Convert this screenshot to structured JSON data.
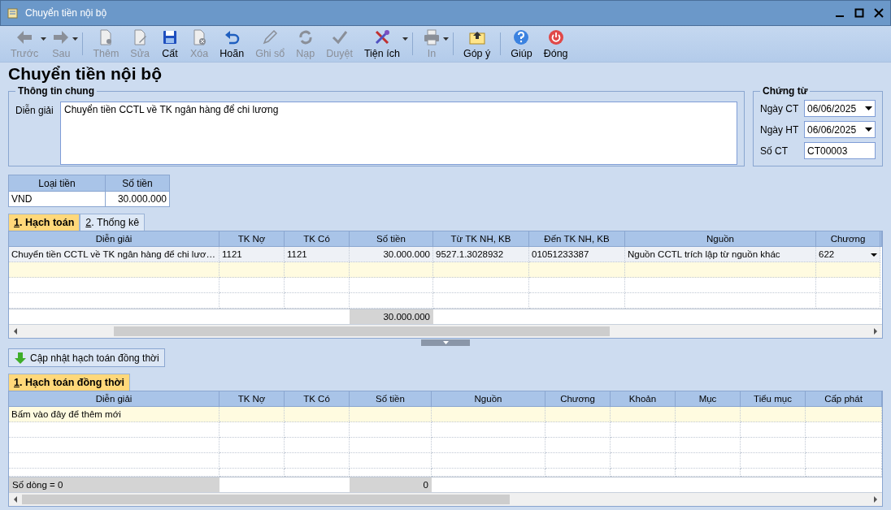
{
  "window": {
    "title": "Chuyển tiền nội bộ"
  },
  "toolbar": [
    [
      {
        "label": "Trước",
        "disabled": true,
        "dropdown": true
      },
      {
        "label": "Sau",
        "disabled": true,
        "dropdown": true
      }
    ],
    [
      {
        "label": "Thêm",
        "disabled": true,
        "dropdown": false
      },
      {
        "label": "Sửa",
        "disabled": true,
        "dropdown": false
      },
      {
        "label": "Cất",
        "disabled": false,
        "dropdown": false
      },
      {
        "label": "Xóa",
        "disabled": true,
        "dropdown": false
      },
      {
        "label": "Hoãn",
        "disabled": false,
        "dropdown": false
      },
      {
        "label": "Ghi sổ",
        "disabled": true,
        "dropdown": false
      },
      {
        "label": "Nạp",
        "disabled": true,
        "dropdown": false
      },
      {
        "label": "Duyệt",
        "disabled": true,
        "dropdown": false
      },
      {
        "label": "Tiện ích",
        "disabled": false,
        "dropdown": true
      }
    ],
    [
      {
        "label": "In",
        "disabled": true,
        "dropdown": true
      }
    ],
    [
      {
        "label": "Góp ý",
        "disabled": false,
        "dropdown": false
      }
    ],
    [
      {
        "label": "Giúp",
        "disabled": false,
        "dropdown": false
      },
      {
        "label": "Đóng",
        "disabled": false,
        "dropdown": false
      }
    ]
  ],
  "heading": "Chuyển tiền nội bộ",
  "general": {
    "title": "Thông tin chung",
    "label": "Diễn giải",
    "value": "Chuyển tiền CCTL về TK ngân hàng để chi lương"
  },
  "voucher": {
    "title": "Chứng từ",
    "fields": [
      {
        "label": "Ngày CT",
        "value": "06/06/2025",
        "kind": "date"
      },
      {
        "label": "Ngày HT",
        "value": "06/06/2025",
        "kind": "date"
      },
      {
        "label": "Số CT",
        "value": "CT00003",
        "kind": "text"
      }
    ]
  },
  "currency": {
    "columns": [
      "Loại tiền",
      "Số tiền"
    ],
    "rows": [
      [
        "VND",
        "30.000.000"
      ]
    ]
  },
  "grids": [
    {
      "tabs": [
        {
          "label": "1. Hạch toán",
          "selected": true
        },
        {
          "label": "2. Thống kê",
          "selected": false
        }
      ],
      "columns": [
        "Diễn giải",
        "TK Nợ",
        "TK Có",
        "Số tiền",
        "Từ TK NH, KB",
        "Đến TK NH, KB",
        "Nguồn",
        "Chương"
      ],
      "rows": [
        {
          "kind": "data",
          "selected": true,
          "cells": [
            "Chuyển tiền CCTL về TK ngân hàng để chi lươ…",
            "1121",
            "1121",
            "30.000.000",
            "9527.1.3028932",
            "01051233387",
            "Nguồn CCTL trích lập từ nguồn khác",
            "622"
          ]
        },
        {
          "kind": "new",
          "selected": false
        }
      ],
      "footer": {
        "total": "30.000.000"
      }
    },
    {
      "tabs": [
        {
          "label": "1. Hạch toán đồng thời",
          "selected": true
        }
      ],
      "columns": [
        "Diễn giải",
        "TK Nợ",
        "TK Có",
        "Số tiền",
        "Nguồn",
        "Chương",
        "Khoản",
        "Mục",
        "Tiểu mục",
        "Cấp phát"
      ],
      "rows": [
        {
          "kind": "new",
          "selected": false,
          "text": "Bấm vào đây để thêm mới"
        }
      ],
      "footer": {
        "row_count": "Số dòng = 0",
        "total": "0"
      }
    }
  ],
  "update_button": {
    "label": "Cập nhật hạch toán đồng thời"
  }
}
